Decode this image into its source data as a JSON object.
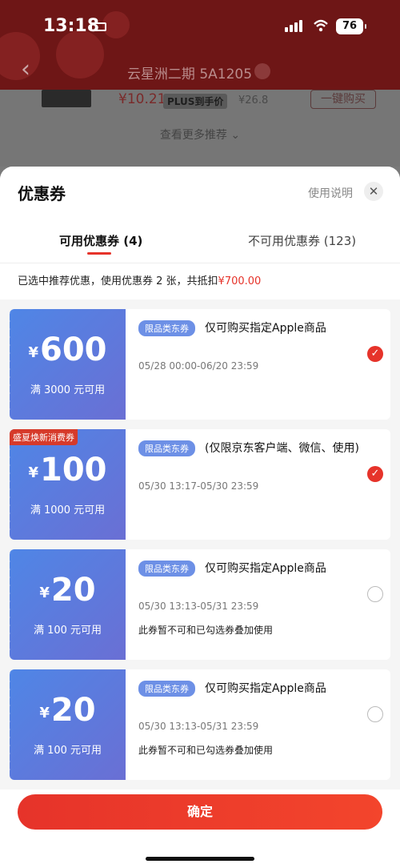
{
  "status": {
    "time": "13:18",
    "battery": "76"
  },
  "background": {
    "nav_title": "云星洲二期 5A1205",
    "product_price": "¥10.21",
    "plus_label": "PLUS到手价",
    "old_price": "¥26.8",
    "buy_label": "一键购买",
    "more_label": "查看更多推荐 ⌄"
  },
  "sheet": {
    "title": "优惠券",
    "help": "使用说明",
    "tabs": [
      {
        "label": "可用优惠券 (4)",
        "active": true
      },
      {
        "label": "不可用优惠券 (123)",
        "active": false
      }
    ],
    "summary_prefix": "已选中推荐优惠，使用优惠券 2 张，共抵扣",
    "summary_amount": "¥700.00"
  },
  "coupons": [
    {
      "symbol": "¥",
      "amount": "600",
      "condition": "满 3000 元可用",
      "tag": "限品类东券",
      "desc": "仅可购买指定Apple商品",
      "date": "05/28 00:00-06/20 23:59",
      "note": "",
      "badge": "",
      "selected": true
    },
    {
      "symbol": "¥",
      "amount": "100",
      "condition": "满 1000 元可用",
      "tag": "限品类东券",
      "desc": "(仅限京东客户端、微信、使用)",
      "date": "05/30 13:17-05/30 23:59",
      "note": "",
      "badge": "盛夏焕新消费券",
      "selected": true
    },
    {
      "symbol": "¥",
      "amount": "20",
      "condition": "满 100 元可用",
      "tag": "限品类东券",
      "desc": "仅可购买指定Apple商品",
      "date": "05/30 13:13-05/31 23:59",
      "note": "此券暂不可和已勾选券叠加使用",
      "badge": "",
      "selected": false
    },
    {
      "symbol": "¥",
      "amount": "20",
      "condition": "满 100 元可用",
      "tag": "限品类东券",
      "desc": "仅可购买指定Apple商品",
      "date": "05/30 13:13-05/31 23:59",
      "note": "此券暂不可和已勾选券叠加使用",
      "badge": "",
      "selected": false
    }
  ],
  "confirm_label": "确定",
  "colors": {
    "accent": "#e6332a",
    "coupon_blue": "#4f86e6"
  }
}
